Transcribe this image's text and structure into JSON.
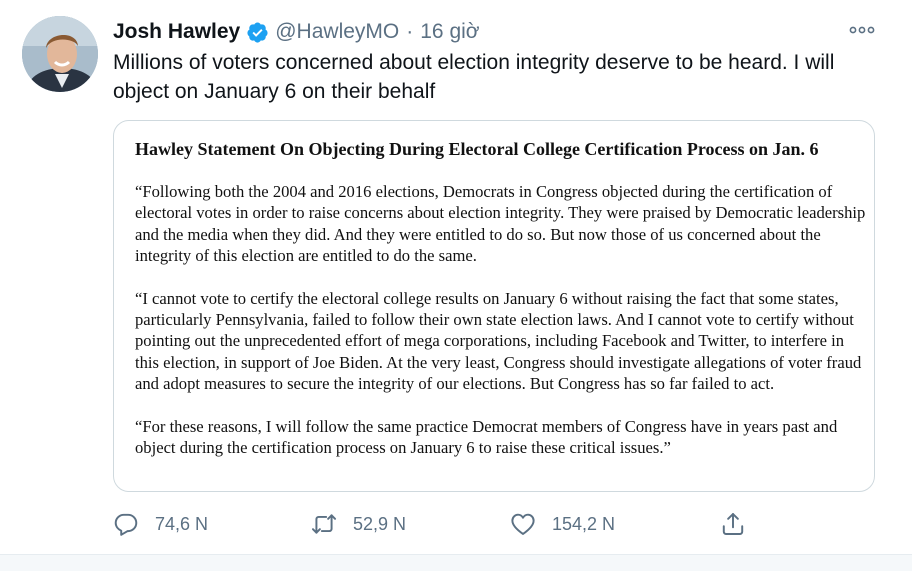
{
  "tweet": {
    "author": {
      "display_name": "Josh Hawley",
      "handle": "@HawleyMO",
      "verified_icon": "verified-badge-icon",
      "avatar_icon": "avatar"
    },
    "separator": "·",
    "timestamp": "16 giờ",
    "more_icon": "more-options-icon",
    "text": "Millions of voters concerned about election integrity deserve to be heard. I will object on January 6 on their behalf",
    "attachment": {
      "title": "Hawley Statement On Objecting During Electoral College Certification Process on Jan. 6",
      "paragraphs": [
        "“Following both the 2004 and 2016 elections, Democrats in Congress objected during the certification of electoral votes in order to raise concerns about election integrity. They were praised by Democratic leadership and the media when they did. And they were entitled to do so. But now those of us concerned about the integrity of this election are entitled to do the same.",
        "“I cannot vote to certify the electoral college results on January 6 without raising the fact that some states, particularly Pennsylvania, failed to follow their own state election laws. And I cannot vote to certify without pointing out the unprecedented effort of mega corporations, including Facebook and Twitter, to interfere in this election, in support of Joe Biden. At the very least, Congress should investigate allegations of voter fraud and adopt measures to secure the integrity of our elections. But Congress has so far failed to act.",
        "“For these reasons, I will follow the same practice Democrat members of Congress have in years past and object during the certification process on January 6 to raise these critical issues.”"
      ]
    },
    "actions": {
      "reply": {
        "icon": "reply-icon",
        "count": "74,6 N"
      },
      "retweet": {
        "icon": "retweet-icon",
        "count": "52,9 N"
      },
      "like": {
        "icon": "heart-icon",
        "count": "154,2 N"
      },
      "share": {
        "icon": "share-icon"
      }
    }
  },
  "colors": {
    "verified": "#1da1f2",
    "secondary_text": "#5b7083",
    "primary_text": "#0f1419",
    "border": "#cfd9de"
  }
}
